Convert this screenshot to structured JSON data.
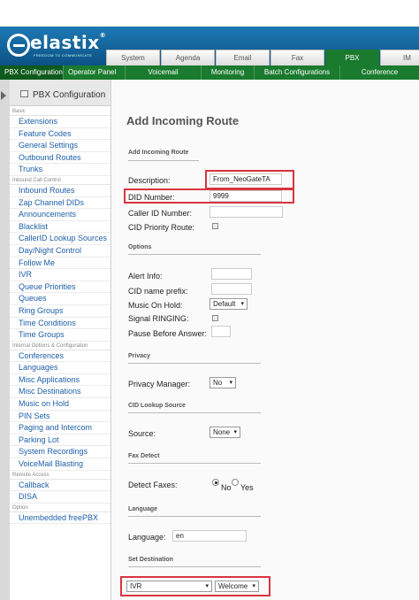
{
  "logo": {
    "text": "elastix",
    "reg": "®",
    "tagline": "FREEDOM TO COMMUNICATE"
  },
  "top_tabs": [
    "System",
    "Agenda",
    "Email",
    "Fax",
    "PBX",
    "IM"
  ],
  "active_top_tab": "PBX",
  "subnav": [
    "PBX Configuration",
    "Operator Panel",
    "Voicemail",
    "Monitoring",
    "Batch Configurations",
    "Conference"
  ],
  "active_subnav": "PBX Configuration",
  "sidebar": {
    "title": "PBX Configuration",
    "sections": [
      {
        "label": "Basic",
        "items": [
          "Extensions",
          "Feature Codes",
          "General Settings",
          "Outbound Routes",
          "Trunks"
        ]
      },
      {
        "label": "Inbound Call Control",
        "items": [
          "Inbound Routes",
          "Zap Channel DIDs",
          "Announcements",
          "Blacklist",
          "CallerID Lookup Sources",
          "Day/Night Control",
          "Follow Me",
          "IVR",
          "Queue Priorities",
          "Queues",
          "Ring Groups",
          "Time Conditions",
          "Time Groups"
        ]
      },
      {
        "label": "Internal Options & Configuration",
        "items": [
          "Conferences",
          "Languages",
          "Misc Applications",
          "Misc Destinations",
          "Music on Hold",
          "PIN Sets",
          "Paging and Intercom",
          "Parking Lot",
          "System Recordings",
          "VoiceMail Blasting"
        ]
      },
      {
        "label": "Remote Access",
        "items": [
          "Callback",
          "DISA"
        ]
      },
      {
        "label": "Option",
        "items": [
          "Unembedded freePBX"
        ]
      }
    ]
  },
  "form": {
    "heading": "Add Incoming Route",
    "sec_route": "Add Incoming Route",
    "description_label": "Description:",
    "description_value": "From_NeoGateTA",
    "did_label": "DID Number:",
    "did_value": "9999",
    "callerid_label": "Caller ID Number:",
    "callerid_value": "",
    "cid_priority_label": "CID Priority Route:",
    "sec_options": "Options",
    "alert_label": "Alert Info:",
    "cid_prefix_label": "CID name prefix:",
    "moh_label": "Music On Hold:",
    "moh_value": "Default",
    "signal_label": "Signal RINGING:",
    "pause_label": "Pause Before Answer:",
    "sec_privacy": "Privacy",
    "privacy_label": "Privacy Manager:",
    "privacy_value": "No",
    "sec_cid_lookup": "CID Lookup Source",
    "source_label": "Source:",
    "source_value": "None",
    "sec_fax": "Fax Detect",
    "detect_faxes_label": "Detect Faxes:",
    "fax_no": "No",
    "fax_yes": "Yes",
    "sec_language": "Language",
    "language_label": "Language:",
    "language_value": "en",
    "sec_destination": "Set Destination",
    "dest_type_value": "IVR",
    "dest_value": "Welcome"
  },
  "colors": {
    "header_blue": "#0c5a8f",
    "nav_green": "#1a7a2e",
    "link_blue": "#1d5fa9",
    "highlight_red": "#d9343f"
  }
}
